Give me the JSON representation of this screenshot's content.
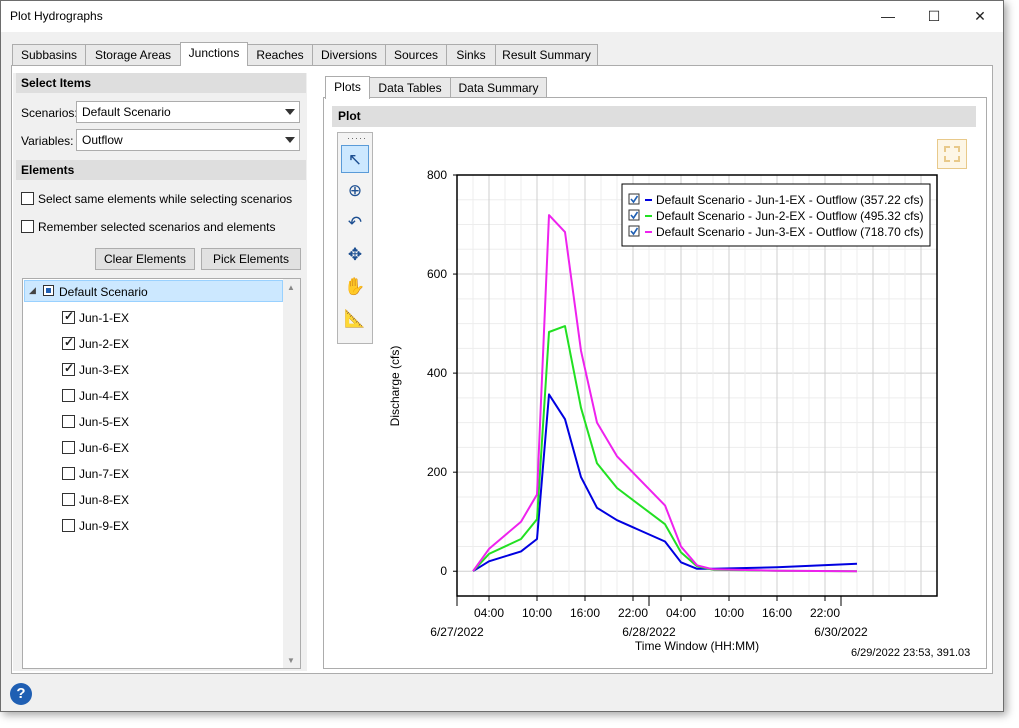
{
  "window": {
    "title": "Plot Hydrographs",
    "minimize": "—",
    "maximize": "☐",
    "close": "✕"
  },
  "tabs": [
    "Subbasins",
    "Storage Areas",
    "Junctions",
    "Reaches",
    "Diversions",
    "Sources",
    "Sinks",
    "Result Summary"
  ],
  "active_tab": "Junctions",
  "left": {
    "select_items_header": "Select Items",
    "scenarios_label": "Scenarios:",
    "scenarios_value": "Default Scenario",
    "variables_label": "Variables:",
    "variables_value": "Outflow",
    "elements_header": "Elements",
    "opt_same_elements": "Select same elements while selecting scenarios",
    "opt_remember": "Remember selected scenarios and elements",
    "clear_button": "Clear Elements",
    "pick_button": "Pick Elements",
    "tree_root": "Default Scenario",
    "tree_items": [
      {
        "label": "Jun-1-EX",
        "checked": true
      },
      {
        "label": "Jun-2-EX",
        "checked": true
      },
      {
        "label": "Jun-3-EX",
        "checked": true
      },
      {
        "label": "Jun-4-EX",
        "checked": false
      },
      {
        "label": "Jun-5-EX",
        "checked": false
      },
      {
        "label": "Jun-6-EX",
        "checked": false
      },
      {
        "label": "Jun-7-EX",
        "checked": false
      },
      {
        "label": "Jun-8-EX",
        "checked": false
      },
      {
        "label": "Jun-9-EX",
        "checked": false
      }
    ]
  },
  "right": {
    "subtabs": [
      "Plots",
      "Data Tables",
      "Data Summary"
    ],
    "plot_header": "Plot",
    "cursor_readout": "6/29/2022 23:53, 391.03"
  },
  "chart_data": {
    "type": "line",
    "ylabel": "Discharge (cfs)",
    "xlabel": "Time Window (HH:MM)",
    "ylim": [
      -50,
      800
    ],
    "yticks": [
      0,
      200,
      400,
      600,
      800
    ],
    "xlim": [
      0,
      60
    ],
    "xtick_hours": [
      4,
      10,
      16,
      22,
      28,
      34,
      40,
      46
    ],
    "xtick_labels": [
      "04:00",
      "10:00",
      "16:00",
      "22:00",
      "04:00",
      "10:00",
      "16:00",
      "22:00"
    ],
    "date_labels": [
      {
        "hour": 0,
        "label": "6/27/2022"
      },
      {
        "hour": 24,
        "label": "6/28/2022"
      },
      {
        "hour": 48,
        "label": "6/30/2022"
      }
    ],
    "grid": true,
    "legend_position": "top-right",
    "series": [
      {
        "name": "Default Scenario - Jun-1-EX - Outflow (357.22 cfs)",
        "color": "#0000e0",
        "x": [
          2,
          4,
          8,
          10,
          11.5,
          13.5,
          15.5,
          17.5,
          20,
          26,
          28,
          30,
          32,
          40,
          50
        ],
        "y": [
          0,
          20,
          40,
          65,
          357,
          307,
          190,
          128,
          103,
          60,
          18,
          5,
          5,
          8,
          15
        ]
      },
      {
        "name": "Default Scenario - Jun-2-EX - Outflow (495.32 cfs)",
        "color": "#22e022",
        "x": [
          2,
          4,
          8,
          10,
          11.5,
          13.5,
          15.5,
          17.5,
          20,
          26,
          28,
          30,
          32,
          40,
          50
        ],
        "y": [
          0,
          35,
          65,
          105,
          483,
          495,
          330,
          218,
          168,
          95,
          38,
          10,
          3,
          1,
          0
        ]
      },
      {
        "name": "Default Scenario - Jun-3-EX - Outflow (718.70 cfs)",
        "color": "#ee22ee",
        "x": [
          2,
          4,
          8,
          10,
          11.5,
          13.5,
          15.5,
          17.5,
          20,
          26,
          28,
          30,
          32,
          40,
          50
        ],
        "y": [
          0,
          45,
          100,
          155,
          719,
          685,
          445,
          300,
          232,
          133,
          50,
          12,
          4,
          1,
          0
        ]
      }
    ]
  }
}
